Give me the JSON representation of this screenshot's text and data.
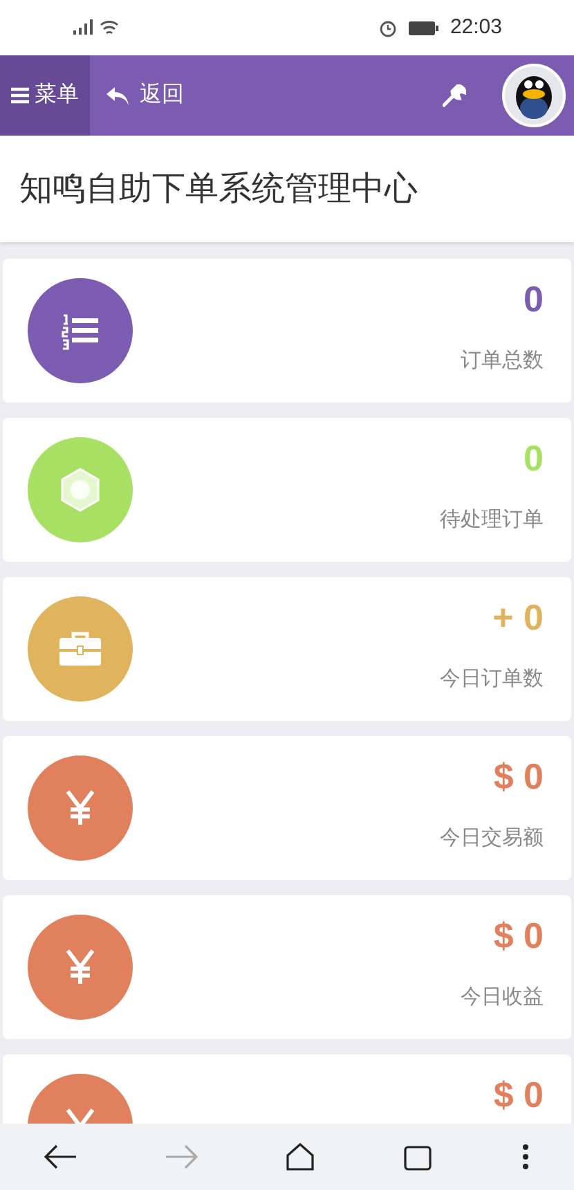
{
  "status_bar": {
    "time": "22:03"
  },
  "header": {
    "menu_label": "菜单",
    "back_label": "返回"
  },
  "page_title": "知鸣自助下单系统管理中心",
  "stats": [
    {
      "kind": "list",
      "color": "#7b5cb0",
      "value": "0",
      "label": "订单总数"
    },
    {
      "kind": "hexagon",
      "color": "#a8e063",
      "value": "0",
      "label": "待处理订单"
    },
    {
      "kind": "briefcase",
      "color": "#e0b45c",
      "value": "+ 0",
      "label": "今日订单数"
    },
    {
      "kind": "yen",
      "color": "#e0805c",
      "value": "$ 0",
      "label": "今日交易额"
    },
    {
      "kind": "yen",
      "color": "#e0805c",
      "value": "$ 0",
      "label": "今日收益"
    },
    {
      "kind": "yen",
      "color": "#e0805c",
      "value": "$ 0"
    }
  ],
  "browser_bar": {
    "forward_disabled": true
  }
}
